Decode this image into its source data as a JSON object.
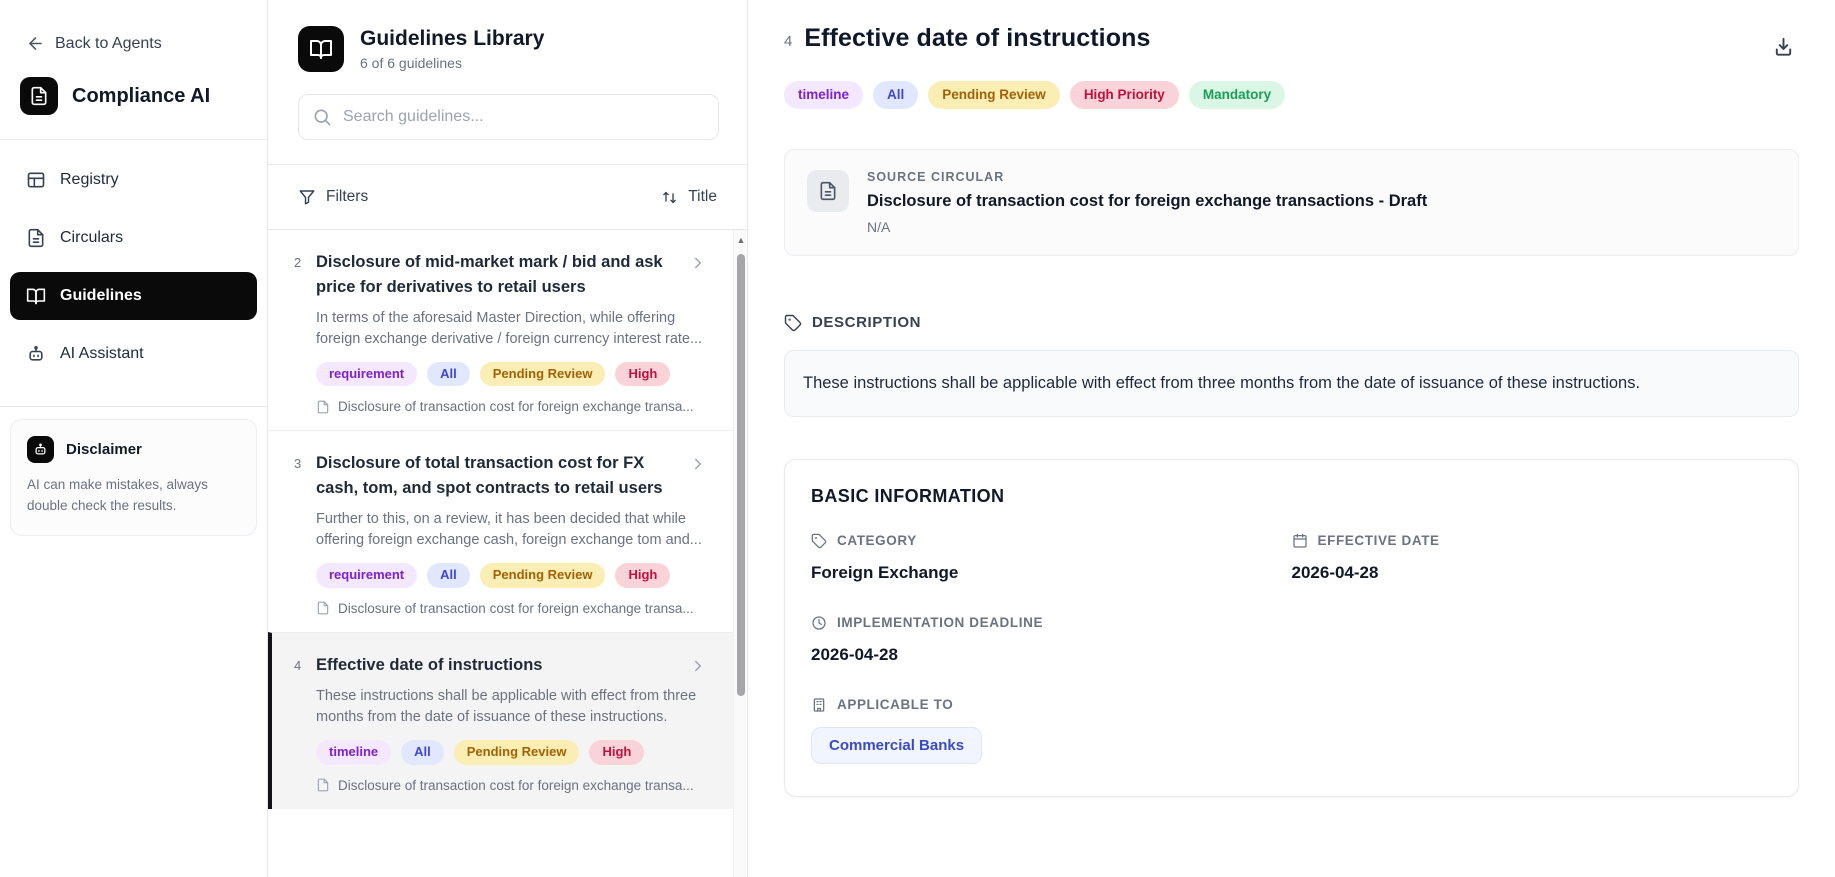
{
  "colors": {
    "accent_black": "#0a0a0a",
    "chip_purple_bg": "#f3e8ff",
    "chip_purple_text": "#7e22ce",
    "chip_indigo_bg": "#e0e7ff",
    "chip_indigo_text": "#4247cf",
    "chip_yellow_bg": "#fbeeb4",
    "chip_yellow_text": "#a16207",
    "chip_red_bg": "#fad3d9",
    "chip_red_text": "#be123c",
    "chip_green_bg": "#d9f7e4",
    "chip_green_text": "#1a9e57",
    "applicable_chip_text": "#3b4ac5"
  },
  "sidebar": {
    "back_label": "Back to Agents",
    "brand": "Compliance AI",
    "nav": [
      {
        "label": "Registry"
      },
      {
        "label": "Circulars"
      },
      {
        "label": "Guidelines"
      },
      {
        "label": "AI Assistant"
      }
    ],
    "disclaimer": {
      "title": "Disclaimer",
      "body": "AI can make mistakes, always double check the results."
    }
  },
  "library": {
    "title": "Guidelines Library",
    "count": "6 of 6 guidelines",
    "search_placeholder": "Search guidelines...",
    "filters_label": "Filters",
    "sort_label": "Title",
    "items": [
      {
        "num": "2",
        "title": "Disclosure of mid-market mark / bid and ask price for derivatives to retail users",
        "desc": "In terms of the aforesaid Master Direction, while offering foreign exchange derivative / foreign currency interest rate...",
        "tags": [
          "requirement",
          "All",
          "Pending Review",
          "High"
        ],
        "source": "Disclosure of transaction cost for foreign exchange transa..."
      },
      {
        "num": "3",
        "title": "Disclosure of total transaction cost for FX cash, tom, and spot contracts to retail users",
        "desc": "Further to this, on a review, it has been decided that while offering foreign exchange cash, foreign exchange tom and...",
        "tags": [
          "requirement",
          "All",
          "Pending Review",
          "High"
        ],
        "source": "Disclosure of transaction cost for foreign exchange transa..."
      },
      {
        "num": "4",
        "title": "Effective date of instructions",
        "desc": "These instructions shall be applicable with effect from three months from the date of issuance of these instructions.",
        "tags": [
          "timeline",
          "All",
          "Pending Review",
          "High"
        ],
        "source": "Disclosure of transaction cost for foreign exchange transa..."
      }
    ]
  },
  "detail": {
    "num": "4",
    "title": "Effective date of instructions",
    "tags": [
      "timeline",
      "All",
      "Pending Review",
      "High Priority",
      "Mandatory"
    ],
    "source": {
      "label": "SOURCE CIRCULAR",
      "title": "Disclosure of transaction cost for foreign exchange transactions - Draft",
      "sub": "N/A"
    },
    "description": {
      "label": "DESCRIPTION",
      "body": "These instructions shall be applicable with effect from three months from the date of issuance of these instructions."
    },
    "basic": {
      "heading": "BASIC INFORMATION",
      "category": {
        "label": "CATEGORY",
        "value": "Foreign Exchange"
      },
      "effective": {
        "label": "EFFECTIVE DATE",
        "value": "2026-04-28"
      },
      "deadline": {
        "label": "IMPLEMENTATION DEADLINE",
        "value": "2026-04-28"
      },
      "applicable": {
        "label": "APPLICABLE TO",
        "chip": "Commercial Banks"
      }
    }
  }
}
